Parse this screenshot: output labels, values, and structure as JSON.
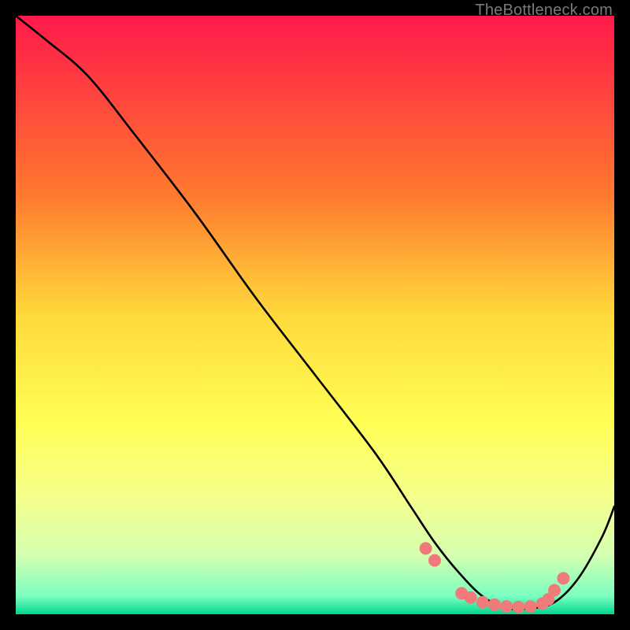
{
  "watermark": "TheBottleneck.com",
  "chart_data": {
    "type": "line",
    "title": "",
    "xlabel": "",
    "ylabel": "",
    "xlim": [
      0,
      100
    ],
    "ylim": [
      0,
      100
    ],
    "grid": false,
    "legend": false,
    "background_gradient_stops": [
      {
        "offset": 0.0,
        "color": "#ff1a4b"
      },
      {
        "offset": 0.12,
        "color": "#ff3f3f"
      },
      {
        "offset": 0.3,
        "color": "#ff7a2f"
      },
      {
        "offset": 0.5,
        "color": "#ffd93b"
      },
      {
        "offset": 0.68,
        "color": "#ffff55"
      },
      {
        "offset": 0.8,
        "color": "#f6ff8a"
      },
      {
        "offset": 0.9,
        "color": "#d6ffb0"
      },
      {
        "offset": 0.97,
        "color": "#7affc0"
      },
      {
        "offset": 1.0,
        "color": "#00d68f"
      }
    ],
    "curve": {
      "x": [
        0,
        5,
        12,
        20,
        30,
        40,
        50,
        60,
        66,
        70,
        74,
        78,
        82,
        86,
        90,
        94,
        98,
        100
      ],
      "y": [
        100,
        96,
        90,
        80,
        67,
        53,
        40,
        27,
        18,
        12,
        7,
        3,
        1,
        1,
        2,
        6,
        13,
        18
      ]
    },
    "markers": {
      "x": [
        68.5,
        70,
        74.5,
        76,
        78,
        80,
        82,
        84,
        86,
        88,
        89,
        90,
        91.5
      ],
      "y": [
        11,
        9,
        3.5,
        2.8,
        2.0,
        1.6,
        1.3,
        1.2,
        1.3,
        1.8,
        2.5,
        4.0,
        6.0
      ],
      "color": "#f07a7a",
      "radius": 8
    }
  }
}
